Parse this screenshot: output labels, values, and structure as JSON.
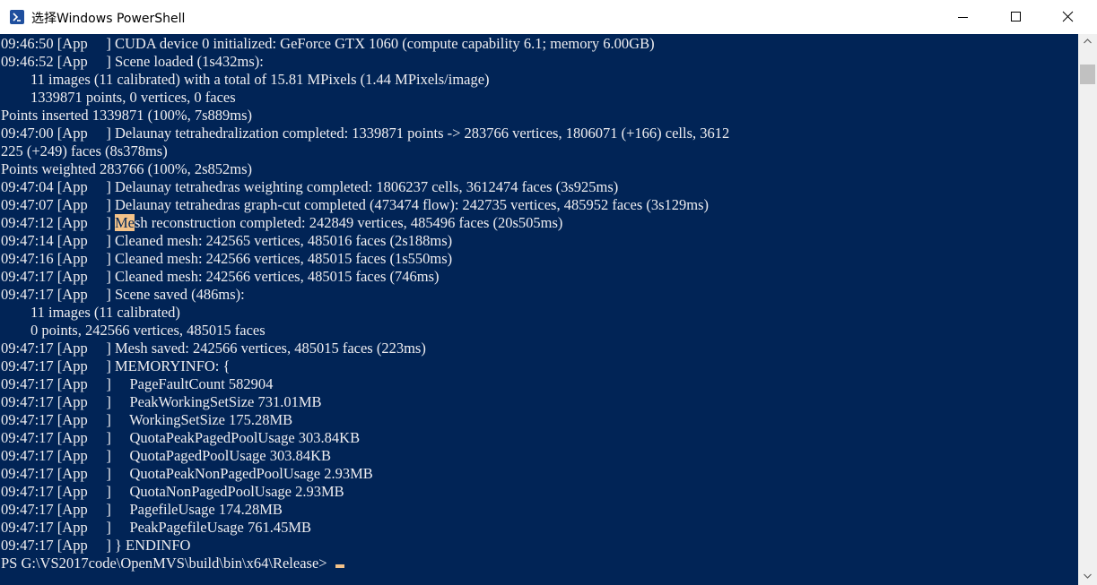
{
  "window": {
    "title": "选择Windows PowerShell"
  },
  "console": {
    "lines": [
      "09:46:50 [App     ] CUDA device 0 initialized: GeForce GTX 1060 (compute capability 6.1; memory 6.00GB)",
      "09:46:52 [App     ] Scene loaded (1s432ms):",
      "        11 images (11 calibrated) with a total of 15.81 MPixels (1.44 MPixels/image)",
      "        1339871 points, 0 vertices, 0 faces",
      "Points inserted 1339871 (100%, 7s889ms)",
      "09:47:00 [App     ] Delaunay tetrahedralization completed: 1339871 points -> 283766 vertices, 1806071 (+166) cells, 3612",
      "225 (+249) faces (8s378ms)",
      "Points weighted 283766 (100%, 2s852ms)",
      "09:47:04 [App     ] Delaunay tetrahedras weighting completed: 1806237 cells, 3612474 faces (3s925ms)",
      "09:47:07 [App     ] Delaunay tetrahedras graph-cut completed (473474 flow): 242735 vertices, 485952 faces (3s129ms)",
      "09:47:12 [App     ] Mesh reconstruction completed: 242849 vertices, 485496 faces (20s505ms)",
      "09:47:14 [App     ] Cleaned mesh: 242565 vertices, 485016 faces (2s188ms)",
      "09:47:16 [App     ] Cleaned mesh: 242566 vertices, 485015 faces (1s550ms)",
      "09:47:17 [App     ] Cleaned mesh: 242566 vertices, 485015 faces (746ms)",
      "09:47:17 [App     ] Scene saved (486ms):",
      "        11 images (11 calibrated)",
      "        0 points, 242566 vertices, 485015 faces",
      "09:47:17 [App     ] Mesh saved: 242566 vertices, 485015 faces (223ms)",
      "09:47:17 [App     ] MEMORYINFO: {",
      "09:47:17 [App     ]     PageFaultCount 582904",
      "09:47:17 [App     ]     PeakWorkingSetSize 731.01MB",
      "09:47:17 [App     ]     WorkingSetSize 175.28MB",
      "09:47:17 [App     ]     QuotaPeakPagedPoolUsage 303.84KB",
      "09:47:17 [App     ]     QuotaPagedPoolUsage 303.84KB",
      "09:47:17 [App     ]     QuotaPeakNonPagedPoolUsage 2.93MB",
      "09:47:17 [App     ]     QuotaNonPagedPoolUsage 2.93MB",
      "09:47:17 [App     ]     PagefileUsage 174.28MB",
      "09:47:17 [App     ]     PeakPagefileUsage 761.45MB",
      "09:47:17 [App     ] } ENDINFO"
    ],
    "highlight": {
      "line_index": 10,
      "text": "Me"
    },
    "prompt": "PS G:\\VS2017code\\OpenMVS\\build\\bin\\x64\\Release>"
  },
  "colors": {
    "console_bg": "#012456",
    "console_fg": "#eeedf0",
    "selection": "#f3c289"
  }
}
